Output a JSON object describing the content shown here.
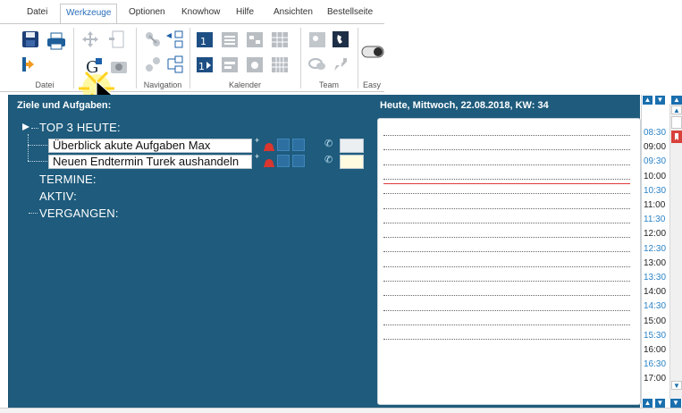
{
  "menu": {
    "tabs": [
      "Datei",
      "Werkzeuge",
      "Optionen",
      "Knowhow",
      "Hilfe",
      "Ansichten",
      "Bestellseite"
    ],
    "active": "Werkzeuge"
  },
  "ribbon": {
    "groups": [
      {
        "label": "Datei"
      },
      {
        "label": ""
      },
      {
        "label": "Navigation"
      },
      {
        "label": "Kalender"
      },
      {
        "label": "Team"
      },
      {
        "label": "Easy"
      }
    ]
  },
  "panel": {
    "left_title": "Ziele und Aufgaben:",
    "right_title": "Heute, Mittwoch, 22.08.2018, KW: 34"
  },
  "tree": {
    "top3": "TOP 3 HEUTE:",
    "tasks": [
      {
        "text": "Überblick akute Aufgaben Max"
      },
      {
        "text": "Neuen Endtermin Turek aushandeln"
      }
    ],
    "termine": "TERMINE:",
    "aktiv": "AKTIV:",
    "vergangen": "VERGANGEN:"
  },
  "times": [
    "08:30",
    "09:00",
    "09:30",
    "10:00",
    "10:30",
    "11:00",
    "11:30",
    "12:00",
    "12:30",
    "13:00",
    "13:30",
    "14:00",
    "14:30",
    "15:00",
    "15:30",
    "16:00",
    "16:30",
    "17:00"
  ],
  "colors": {
    "panel_bg": "#1e5b7c",
    "accent_blue": "#2a6ebb",
    "time_half": "#2a82c6",
    "now_line": "#e23a3a"
  }
}
